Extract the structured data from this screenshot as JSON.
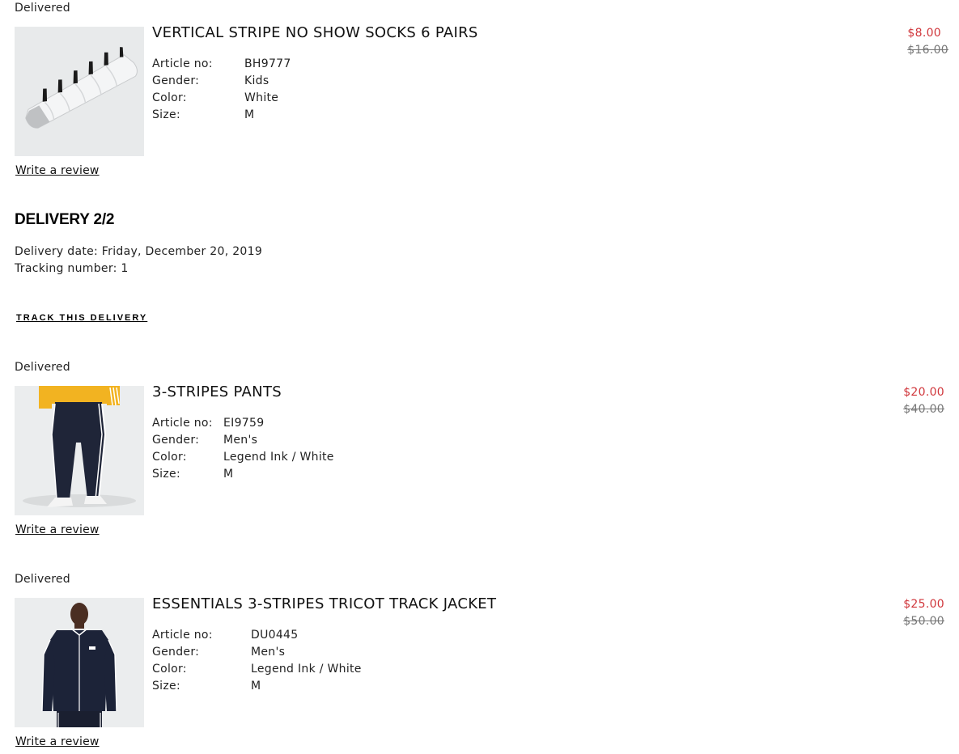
{
  "items_top": {
    "status": "Delivered",
    "product": {
      "title": "VERTICAL STRIPE NO SHOW SOCKS 6 PAIRS",
      "image_icon": "socks-product-image",
      "attributes": [
        {
          "label": "Article no:",
          "value": "BH9777"
        },
        {
          "label": "Gender:",
          "value": "Kids"
        },
        {
          "label": "Color:",
          "value": "White"
        },
        {
          "label": "Size:",
          "value": "M"
        }
      ],
      "sale_price": "$8.00",
      "original_price": "$16.00",
      "review_label": "Write a review"
    }
  },
  "delivery2": {
    "heading": "DELIVERY 2/2",
    "date_label": "Delivery date: Friday, December 20, 2019",
    "tracking_label": "Tracking number: 1",
    "track_label": "TRACK THIS DELIVERY"
  },
  "items": [
    {
      "status": "Delivered",
      "title": "3-STRIPES PANTS",
      "image_icon": "pants-product-image",
      "attributes": [
        {
          "label": "Article no:",
          "value": "EI9759"
        },
        {
          "label": "Gender:",
          "value": "Men's"
        },
        {
          "label": "Color:",
          "value": "Legend Ink / White"
        },
        {
          "label": "Size:",
          "value": "M"
        }
      ],
      "sale_price": "$20.00",
      "original_price": "$40.00",
      "review_label": "Write a review"
    },
    {
      "status": "Delivered",
      "title": "ESSENTIALS 3-STRIPES TRICOT TRACK JACKET",
      "image_icon": "jacket-product-image",
      "attributes": [
        {
          "label": "Article no:",
          "value": "DU0445"
        },
        {
          "label": "Gender:",
          "value": "Men's"
        },
        {
          "label": "Color:",
          "value": "Legend Ink / White"
        },
        {
          "label": "Size:",
          "value": "M"
        }
      ],
      "sale_price": "$25.00",
      "original_price": "$50.00",
      "review_label": "Write a review"
    }
  ],
  "colors": {
    "sale": "#d0363b",
    "original": "#777777",
    "thumb_bg": "#ebedee",
    "legend_ink": "#1c2338"
  }
}
